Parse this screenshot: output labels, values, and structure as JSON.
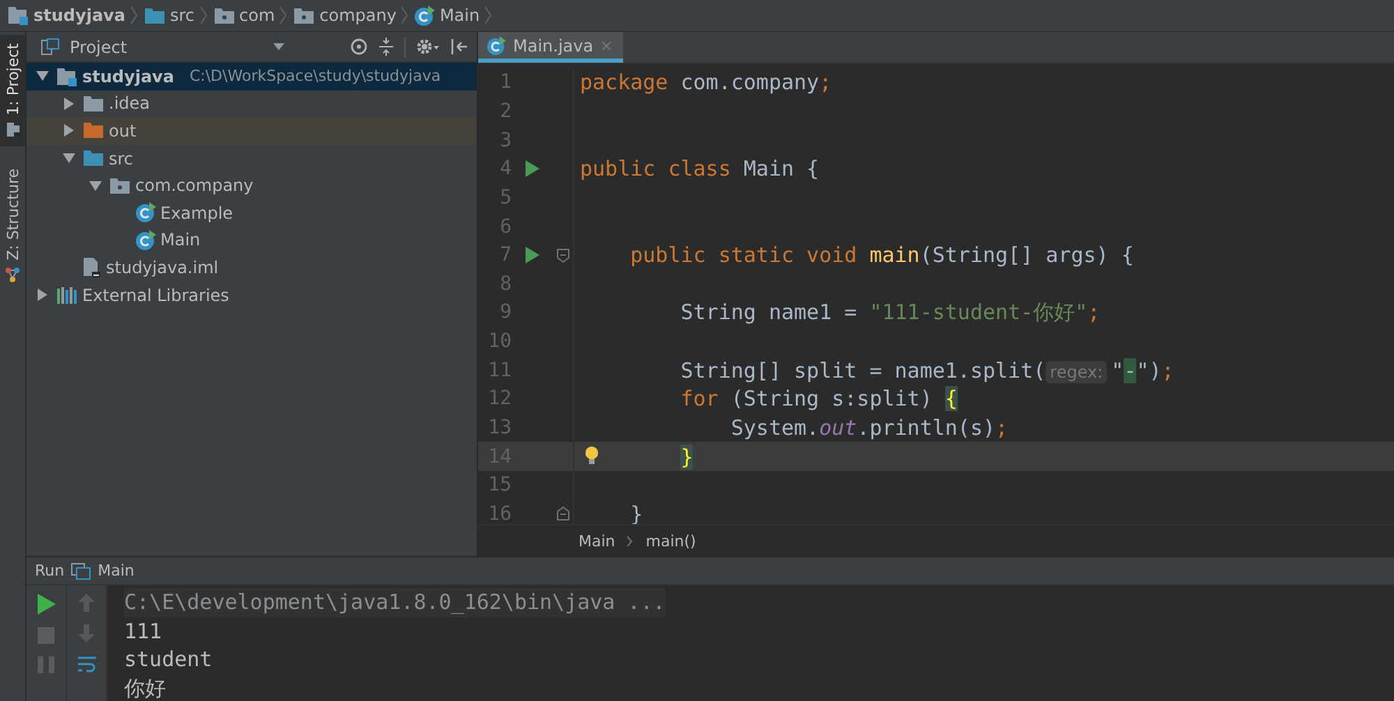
{
  "breadcrumb": [
    {
      "kind": "module",
      "label": "studyjava"
    },
    {
      "kind": "source",
      "label": "src"
    },
    {
      "kind": "package",
      "label": "com"
    },
    {
      "kind": "package",
      "label": "company"
    },
    {
      "kind": "class",
      "label": "Main"
    }
  ],
  "tool_strip": [
    {
      "label": "1: Project",
      "selected": true,
      "kind": "project"
    },
    {
      "label": "Z: Structure",
      "selected": false,
      "kind": "structure"
    }
  ],
  "project_panel": {
    "title": "Project",
    "tree": [
      {
        "kind": "module",
        "label": "studyjava",
        "path": "C:\\D\\WorkSpace\\study\\studyjava",
        "selected": true,
        "expanded": true,
        "children": [
          {
            "kind": "folder",
            "label": ".idea",
            "selected": false,
            "expanded": false
          },
          {
            "kind": "excluded",
            "label": "out",
            "selected": false,
            "expanded": false
          },
          {
            "kind": "source",
            "label": "src",
            "selected": false,
            "expanded": true,
            "children": [
              {
                "kind": "package",
                "label": "com.company",
                "selected": false,
                "expanded": true,
                "children": [
                  {
                    "kind": "class",
                    "label": "Example",
                    "selected": false
                  },
                  {
                    "kind": "class",
                    "label": "Main",
                    "selected": false
                  }
                ]
              }
            ]
          },
          {
            "kind": "file",
            "label": "studyjava.iml",
            "selected": false
          }
        ]
      },
      {
        "kind": "libraries",
        "label": "External Libraries",
        "selected": false,
        "expanded": false
      }
    ]
  },
  "editor": {
    "tabs": [
      {
        "label": "Main.java",
        "selected": true
      }
    ],
    "lines": [
      {
        "number": "1",
        "tokens": [
          {
            "kind": "keyword",
            "text": "package"
          },
          {
            "kind": "plain",
            "text": " com.company"
          },
          {
            "kind": "punct",
            "text": ";"
          }
        ]
      },
      {
        "number": "2"
      },
      {
        "number": "3"
      },
      {
        "number": "4",
        "run": true,
        "tokens": [
          {
            "kind": "keyword",
            "text": "public class"
          },
          {
            "kind": "plain",
            "text": " Main {"
          }
        ]
      },
      {
        "number": "5"
      },
      {
        "number": "6"
      },
      {
        "number": "7",
        "run": true,
        "fold": true,
        "tokens": [
          {
            "kind": "keyword",
            "text": "    public static void "
          },
          {
            "kind": "method",
            "text": "main"
          },
          {
            "kind": "plain",
            "text": "(String[] args) {"
          }
        ]
      },
      {
        "number": "8"
      },
      {
        "number": "9",
        "tokens": [
          {
            "kind": "plain",
            "text": "        String name1 = "
          },
          {
            "kind": "string",
            "text": "\"111-student-你好\""
          },
          {
            "kind": "punct",
            "text": ";"
          }
        ]
      },
      {
        "number": "10"
      },
      {
        "number": "11",
        "tokens": [
          {
            "kind": "plain",
            "text": "        String[] split = name1.split("
          },
          {
            "kind": "hint",
            "text": "regex:"
          },
          {
            "kind": "plain",
            "text": "\""
          },
          {
            "kind": "match",
            "text": "-"
          },
          {
            "kind": "plain",
            "text": "\")"
          },
          {
            "kind": "punct",
            "text": ";"
          }
        ]
      },
      {
        "number": "12",
        "tokens": [
          {
            "kind": "keyword",
            "text": "        for"
          },
          {
            "kind": "plain",
            "text": " (String s:split) "
          },
          {
            "kind": "brace",
            "text": "{"
          }
        ]
      },
      {
        "number": "13",
        "tokens": [
          {
            "kind": "plain",
            "text": "            System."
          },
          {
            "kind": "field",
            "text": "out"
          },
          {
            "kind": "plain",
            "text": ".println(s)"
          },
          {
            "kind": "punct",
            "text": ";"
          }
        ]
      },
      {
        "number": "14",
        "current": true,
        "bulb": true,
        "tokens": [
          {
            "kind": "brace",
            "text": "        }"
          }
        ]
      },
      {
        "number": "15"
      },
      {
        "number": "16",
        "fold_end": true,
        "tokens": [
          {
            "kind": "plain",
            "text": "    }"
          }
        ]
      }
    ],
    "breadcrumb": [
      "Main",
      "main()"
    ]
  },
  "run_panel": {
    "title": "Run",
    "config": "Main",
    "output": [
      {
        "kind": "command",
        "text": "C:\\E\\development\\java1.8.0_162\\bin\\java ..."
      },
      {
        "kind": "stdout",
        "text": "111"
      },
      {
        "kind": "stdout",
        "text": "student"
      },
      {
        "kind": "stdout",
        "text": "你好"
      }
    ]
  }
}
